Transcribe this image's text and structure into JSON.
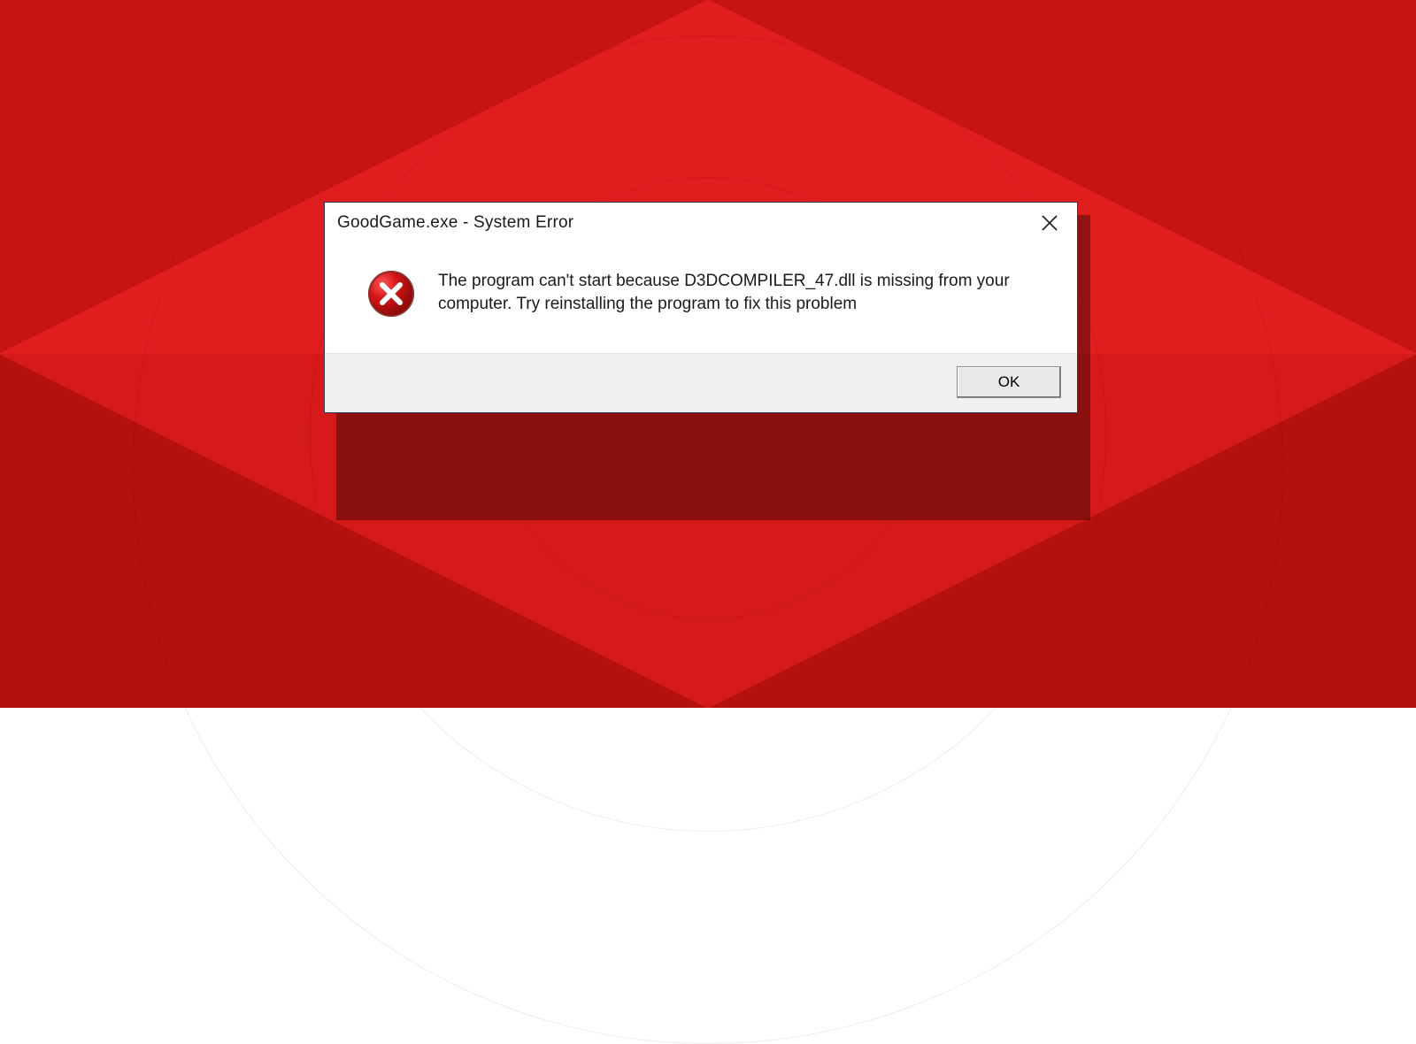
{
  "dialog": {
    "title": "GoodGame.exe - System Error",
    "message": "The program can't start because D3DCOMPILER_47.dll is missing from your computer. Try reinstalling the program to fix this problem",
    "ok_label": "OK",
    "icon": "error-icon"
  }
}
